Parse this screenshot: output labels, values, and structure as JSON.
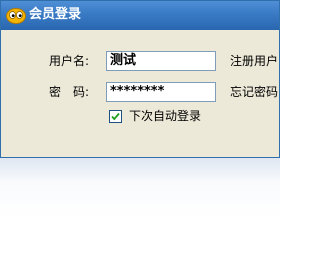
{
  "window": {
    "title": "会员登录",
    "icon": "eyes-icon"
  },
  "form": {
    "username_label": "用户名:",
    "username_value": "测试",
    "password_label": "密　码:",
    "password_value": "********",
    "register_link": "注册用户",
    "forgot_link": "忘记密码",
    "auto_login_label": "下次自动登录",
    "auto_login_checked": true
  },
  "colors": {
    "title_bar": "#3b7cc6",
    "dialog_bg": "#ece9d8",
    "input_border": "#7f9db9"
  }
}
